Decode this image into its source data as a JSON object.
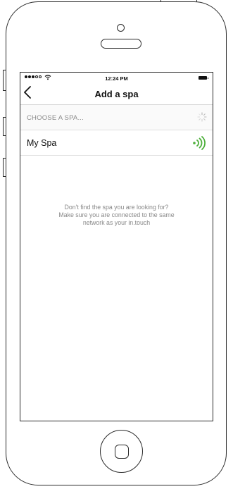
{
  "statusbar": {
    "time": "12:24 PM"
  },
  "navbar": {
    "back_icon": "chevron-left-icon",
    "title": "Add a spa"
  },
  "section": {
    "label": "CHOOSE A SPA...",
    "spinner_icon": "loading-spinner-icon"
  },
  "spas": [
    {
      "name": "My Spa",
      "signal_icon": "wireless-signal-icon",
      "signal_color": "#4caf3a"
    }
  ],
  "help": {
    "line1": "Don't find the spa you are looking for?",
    "line2": "Make sure you are connected to the same",
    "line3": "network as your in.touch"
  }
}
